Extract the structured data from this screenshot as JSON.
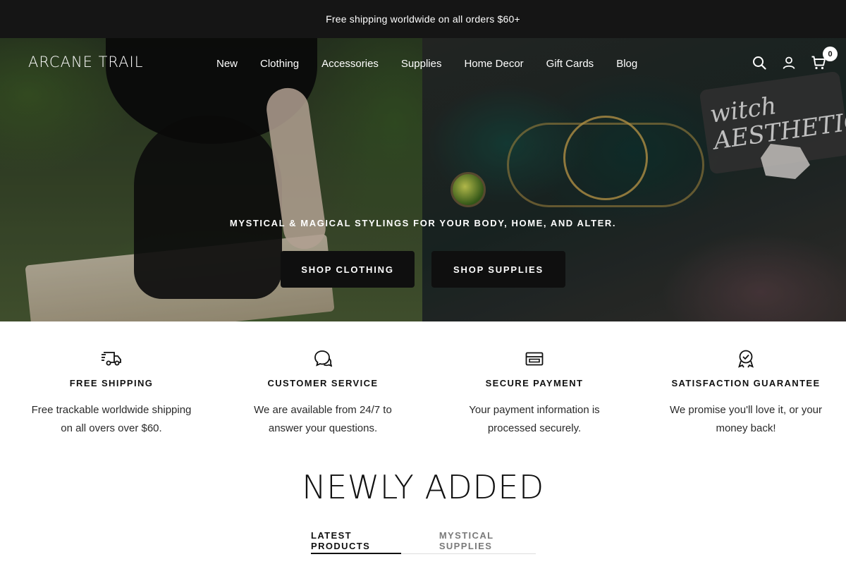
{
  "announcement": {
    "text": "Free shipping worldwide on all orders $60+"
  },
  "header": {
    "logo": "ARCANE TRAIL",
    "nav": [
      {
        "label": "New"
      },
      {
        "label": "Clothing"
      },
      {
        "label": "Accessories"
      },
      {
        "label": "Supplies"
      },
      {
        "label": "Home Decor"
      },
      {
        "label": "Gift Cards"
      },
      {
        "label": "Blog"
      }
    ],
    "icons": {
      "search": "search-icon",
      "account": "user-icon",
      "cart": "cart-icon"
    },
    "cart_count": "0"
  },
  "hero": {
    "sign_text": "witch AESTHETIC",
    "tagline": "MYSTICAL & MAGICAL STYLINGS FOR YOUR BODY, HOME, AND ALTER.",
    "buttons": [
      {
        "label": "SHOP CLOTHING"
      },
      {
        "label": "SHOP SUPPLIES"
      }
    ]
  },
  "features": [
    {
      "icon": "truck-icon",
      "title": "FREE SHIPPING",
      "text": "Free trackable worldwide shipping on all overs over $60."
    },
    {
      "icon": "chat-icon",
      "title": "CUSTOMER SERVICE",
      "text": "We are available from 24/7 to answer your questions."
    },
    {
      "icon": "credit-card-icon",
      "title": "SECURE PAYMENT",
      "text": "Your payment information is processed securely."
    },
    {
      "icon": "award-icon",
      "title": "SATISFACTION GUARANTEE",
      "text": "We promise you'll love it, or your money back!"
    }
  ],
  "newly_added": {
    "title": "NEWLY ADDED",
    "tabs": [
      {
        "label": "LATEST PRODUCTS",
        "active": true
      },
      {
        "label": "MYSTICAL SUPPLIES",
        "active": false
      }
    ]
  },
  "colors": {
    "announcement_bg": "#151515",
    "button_bg": "#0f0f0f",
    "text": "#111111"
  }
}
